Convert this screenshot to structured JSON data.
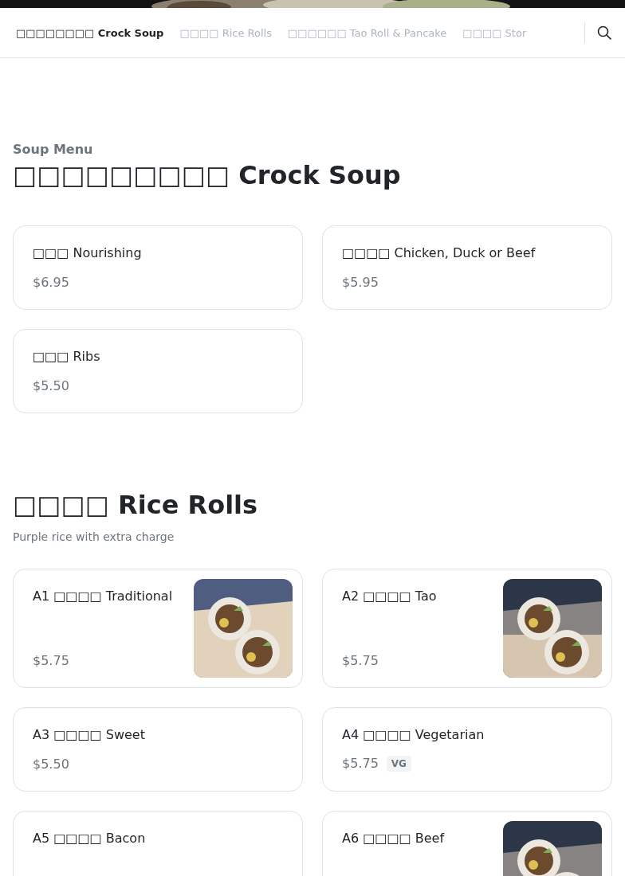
{
  "nav": {
    "tabs": [
      {
        "label": "□□□□□□□□ Crock Soup",
        "selected": true
      },
      {
        "label": "□□□□ Rice Rolls",
        "selected": false
      },
      {
        "label": "□□□□□□ Tao Roll & Pancake",
        "selected": false
      },
      {
        "label": "□□□□ Stor",
        "selected": false
      }
    ]
  },
  "sections": [
    {
      "eyebrow": "Soup Menu",
      "title": "□□□□□□□□□ Crock Soup",
      "items": [
        {
          "name": "□□□ Nourishing",
          "price": "$6.95"
        },
        {
          "name": "□□□□ Chicken, Duck or Beef",
          "price": "$5.95"
        },
        {
          "name": "□□□ Ribs",
          "price": "$5.50"
        }
      ]
    },
    {
      "title": "□□□□ Rice Rolls",
      "note": "Purple rice with extra charge",
      "items": [
        {
          "name": "A1 □□□□ Traditional",
          "price": "$5.75",
          "kind": "picture"
        },
        {
          "name": "A2 □□□□ Tao",
          "price": "$5.75",
          "kind": "picture"
        },
        {
          "name": "A3 □□□□ Sweet",
          "price": "$5.50"
        },
        {
          "name": "A4 □□□□ Vegetarian",
          "price": "$5.75",
          "tag": "VG"
        },
        {
          "name": "A5 □□□□ Bacon"
        },
        {
          "name": "A6 □□□□ Beef",
          "kind": "picture"
        }
      ]
    }
  ]
}
